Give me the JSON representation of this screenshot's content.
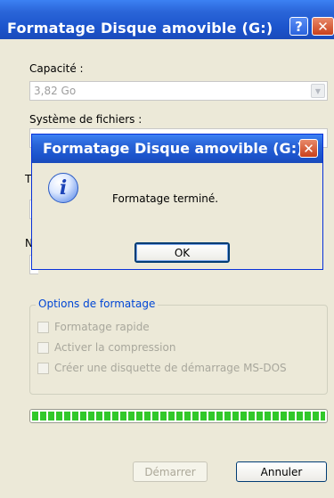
{
  "main_window": {
    "title": "Formatage Disque amovible (G:)",
    "capacity_label": "Capacité :",
    "capacity_value": "3,82 Go",
    "filesystem_label": "Système de fichiers :",
    "partial_label_1": "T",
    "partial_label_2": "N",
    "options_title": "Options de formatage",
    "options": [
      {
        "label": "Formatage rapide",
        "checked": false
      },
      {
        "label": "Activer la compression",
        "checked": false
      },
      {
        "label": "Créer une disquette de démarrage MS-DOS",
        "checked": false
      }
    ],
    "progress_percent": 100,
    "start_button": "Démarrer",
    "cancel_button": "Annuler",
    "help_button_glyph": "?",
    "close_button_glyph": "✕"
  },
  "message_box": {
    "title": "Formatage Disque amovible (G:)",
    "icon": "info-icon",
    "icon_glyph": "i",
    "message": "Formatage terminé.",
    "ok_button": "OK",
    "close_button_glyph": "✕"
  },
  "colors": {
    "titlebar_blue": "#1c54cc",
    "progress_green": "#31c82a",
    "close_red": "#c9401c",
    "group_title_blue": "#0046d5"
  }
}
